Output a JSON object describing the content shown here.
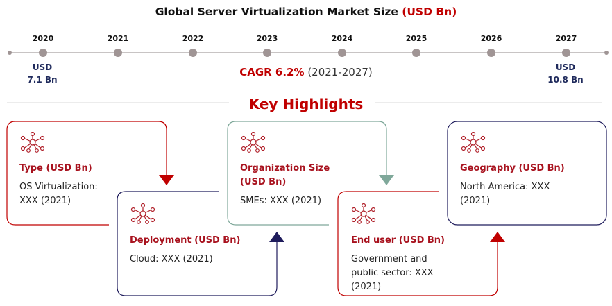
{
  "title": {
    "main": "Global Server Virtualization Market Size",
    "unit": "(USD Bn)"
  },
  "timeline": {
    "years": [
      "2020",
      "2021",
      "2022",
      "2023",
      "2024",
      "2025",
      "2026",
      "2027"
    ],
    "start": {
      "currency": "USD",
      "value": "7.1 Bn"
    },
    "end": {
      "currency": "USD",
      "value": "10.8 Bn"
    },
    "cagr_label": "CAGR 6.2%",
    "cagr_period": "(2021-2027)"
  },
  "key_highlights": "Key Highlights",
  "segments": [
    {
      "label": "Type (USD Bn)",
      "value": "OS Virtualization: XXX (2021)"
    },
    {
      "label": "Deployment (USD Bn)",
      "value": "Cloud: XXX (2021)"
    },
    {
      "label": "Organization Size (USD Bn)",
      "value": "SMEs: XXX (2021)"
    },
    {
      "label": "End user (USD Bn)",
      "value": "Government and public sector: XXX (2021)"
    },
    {
      "label": "Geography (USD Bn)",
      "value": "North America: XXX (2021)"
    }
  ],
  "colors": {
    "red": "#c00000",
    "navy": "#1f1c5c",
    "teal": "#7fa89a",
    "dot": "#a09595"
  },
  "icons": [
    "network-hub-icon",
    "network-hub-icon",
    "network-hub-icon",
    "network-hub-icon",
    "network-hub-icon"
  ]
}
